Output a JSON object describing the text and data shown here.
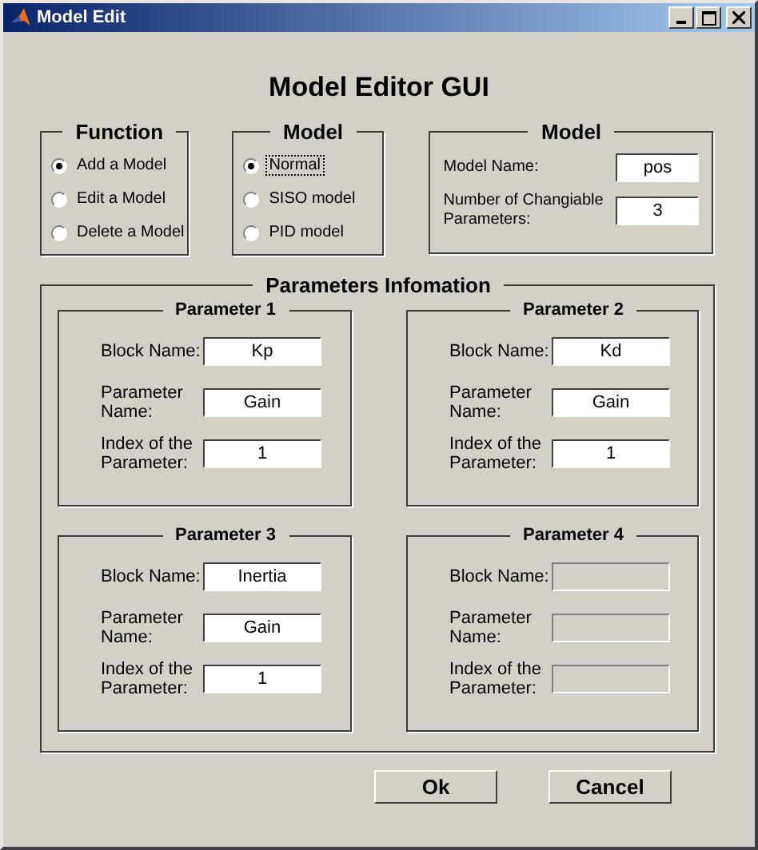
{
  "window": {
    "title": "Model Edit"
  },
  "heading": "Model Editor GUI",
  "function_group": {
    "title": "Function",
    "options": [
      {
        "label": "Add a Model",
        "selected": true
      },
      {
        "label": "Edit a Model",
        "selected": false
      },
      {
        "label": "Delete a Model",
        "selected": false
      }
    ]
  },
  "model_group": {
    "title": "Model",
    "options": [
      {
        "label": "Normal",
        "selected": true,
        "focused": true
      },
      {
        "label": "SISO model",
        "selected": false,
        "focused": false
      },
      {
        "label": "PID model",
        "selected": false,
        "focused": false
      }
    ]
  },
  "model_info": {
    "title": "Model",
    "fields": [
      {
        "label": "Model Name:",
        "value": "pos"
      },
      {
        "label": "Number of Changiable Parameters:",
        "value": "3"
      }
    ]
  },
  "parameters": {
    "title": "Parameters Infomation",
    "panels": [
      {
        "title": "Parameter 1",
        "fields": [
          {
            "label": "Block Name:",
            "value": "Kp",
            "disabled": false
          },
          {
            "label": "Parameter Name:",
            "value": "Gain",
            "disabled": false
          },
          {
            "label": "Index of the Parameter:",
            "value": "1",
            "disabled": false
          }
        ]
      },
      {
        "title": "Parameter 2",
        "fields": [
          {
            "label": "Block Name:",
            "value": "Kd",
            "disabled": false
          },
          {
            "label": "Parameter Name:",
            "value": "Gain",
            "disabled": false
          },
          {
            "label": "Index of the Parameter:",
            "value": "1",
            "disabled": false
          }
        ]
      },
      {
        "title": "Parameter 3",
        "fields": [
          {
            "label": "Block Name:",
            "value": "Inertia",
            "disabled": false
          },
          {
            "label": "Parameter Name:",
            "value": "Gain",
            "disabled": false
          },
          {
            "label": "Index of the Parameter:",
            "value": "1",
            "disabled": false
          }
        ]
      },
      {
        "title": "Parameter 4",
        "fields": [
          {
            "label": "Block Name:",
            "disabled": true
          },
          {
            "label": "Parameter Name:",
            "disabled": true
          },
          {
            "label": "Index of the Parameter:",
            "disabled": true
          }
        ]
      }
    ]
  },
  "buttons": [
    "Ok",
    "Cancel"
  ]
}
